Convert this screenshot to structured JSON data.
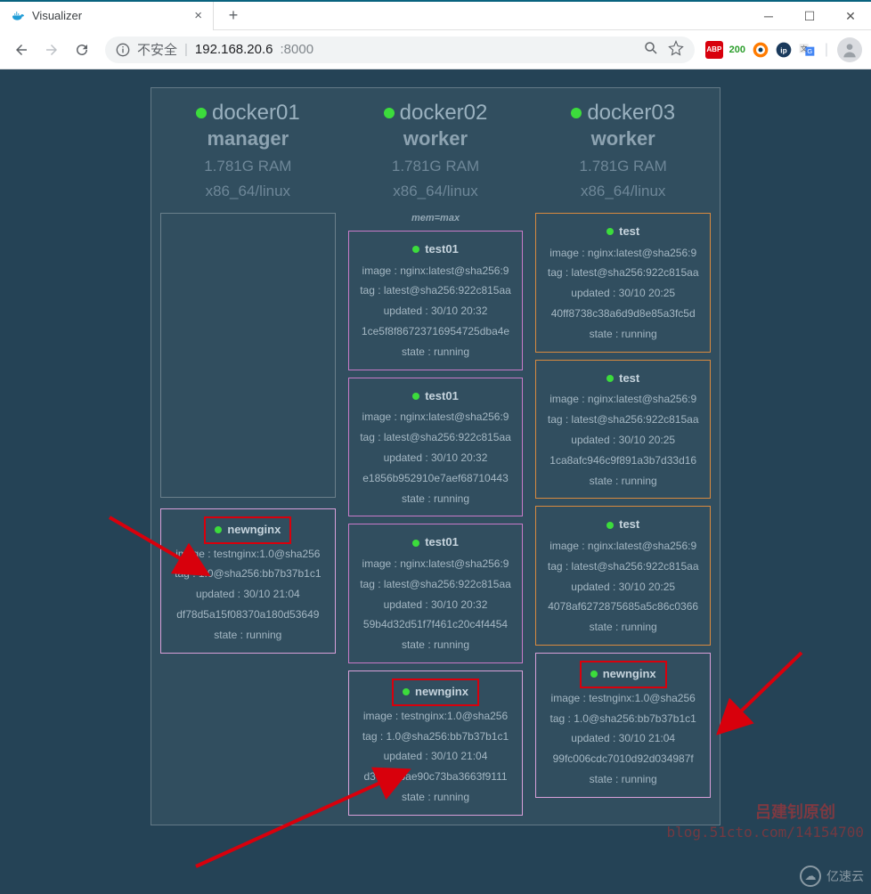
{
  "browser": {
    "tab_title": "Visualizer",
    "insecure_label": "不安全",
    "url_host": "192.168.20.6",
    "url_port": ":8000",
    "ext_badge_abp": "ABP",
    "ext_badge_200": "200"
  },
  "nodes": [
    {
      "name": "docker01",
      "role": "manager",
      "ram": "1.781G RAM",
      "arch": "x86_64/linux",
      "memmax": "",
      "spacer": true,
      "tasks": [
        {
          "title": "newnginx",
          "highlight": true,
          "variant": "pink-light",
          "lines": [
            "image : testnginx:1.0@sha256",
            "tag : 1.0@sha256:bb7b37b1c1",
            "updated : 30/10 21:04",
            "df78d5a15f08370a180d53649",
            "state : running"
          ]
        }
      ]
    },
    {
      "name": "docker02",
      "role": "worker",
      "ram": "1.781G RAM",
      "arch": "x86_64/linux",
      "memmax": "mem=max",
      "spacer": false,
      "tasks": [
        {
          "title": "test01",
          "highlight": false,
          "variant": "pink",
          "lines": [
            "image : nginx:latest@sha256:9",
            "tag : latest@sha256:922c815aa",
            "updated : 30/10 20:32",
            "1ce5f8f86723716954725dba4e",
            "state : running"
          ]
        },
        {
          "title": "test01",
          "highlight": false,
          "variant": "pink",
          "lines": [
            "image : nginx:latest@sha256:9",
            "tag : latest@sha256:922c815aa",
            "updated : 30/10 20:32",
            "e1856b952910e7aef68710443",
            "state : running"
          ]
        },
        {
          "title": "test01",
          "highlight": false,
          "variant": "pink",
          "lines": [
            "image : nginx:latest@sha256:9",
            "tag : latest@sha256:922c815aa",
            "updated : 30/10 20:32",
            "59b4d32d51f7f461c20c4f4454",
            "state : running"
          ]
        },
        {
          "title": "newnginx",
          "highlight": true,
          "variant": "pink-light",
          "lines": [
            "image : testnginx:1.0@sha256",
            "tag : 1.0@sha256:bb7b37b1c1",
            "updated : 30/10 21:04",
            "d369dabae90c73ba3663f9111",
            "state : running"
          ]
        }
      ]
    },
    {
      "name": "docker03",
      "role": "worker",
      "ram": "1.781G RAM",
      "arch": "x86_64/linux",
      "memmax": "",
      "spacer": false,
      "tasks": [
        {
          "title": "test",
          "highlight": false,
          "variant": "orange",
          "lines": [
            "image : nginx:latest@sha256:9",
            "tag : latest@sha256:922c815aa",
            "updated : 30/10 20:25",
            "40ff8738c38a6d9d8e85a3fc5d",
            "state : running"
          ]
        },
        {
          "title": "test",
          "highlight": false,
          "variant": "orange",
          "lines": [
            "image : nginx:latest@sha256:9",
            "tag : latest@sha256:922c815aa",
            "updated : 30/10 20:25",
            "1ca8afc946c9f891a3b7d33d16",
            "state : running"
          ]
        },
        {
          "title": "test",
          "highlight": false,
          "variant": "orange",
          "lines": [
            "image : nginx:latest@sha256:9",
            "tag : latest@sha256:922c815aa",
            "updated : 30/10 20:25",
            "4078af6272875685a5c86c0366",
            "state : running"
          ]
        },
        {
          "title": "newnginx",
          "highlight": true,
          "variant": "pink-light",
          "lines": [
            "image : testnginx:1.0@sha256",
            "tag : 1.0@sha256:bb7b37b1c1",
            "updated : 30/10 21:04",
            "99fc006cdc7010d92d034987f",
            "state : running"
          ]
        }
      ]
    }
  ],
  "watermark": {
    "author": "吕建钊原创",
    "blog": "blog.51cto.com/14154700",
    "brand": "亿速云"
  }
}
